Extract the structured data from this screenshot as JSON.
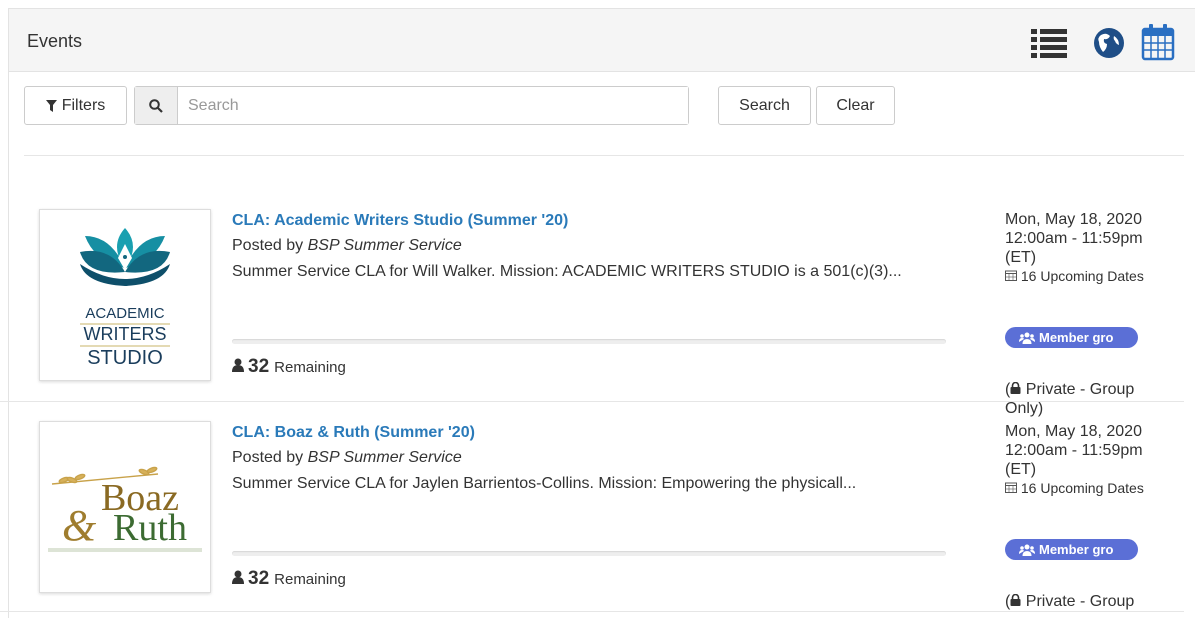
{
  "header": {
    "title": "Events",
    "views": [
      "list-view-icon",
      "globe-icon",
      "calendar-icon"
    ]
  },
  "toolbar": {
    "filters_label": "Filters",
    "search_placeholder": "Search",
    "search_value": "",
    "search_button": "Search",
    "clear_button": "Clear"
  },
  "events": [
    {
      "title": "CLA: Academic Writers Studio (Summer '20)",
      "posted_prefix": "Posted by",
      "posted_by": "BSP Summer Service",
      "description": "Summer Service CLA for Will Walker. Mission: ACADEMIC WRITERS STUDIO is a 501(c)(3)...",
      "remaining_count": "32",
      "remaining_label": "Remaining",
      "date": "Mon, May 18, 2020",
      "time": "12:00am - 11:59pm",
      "tz": "(ET)",
      "upcoming": "16 Upcoming Dates",
      "badge": "Member gro",
      "privacy": "Private - Group Only)",
      "logo": {
        "line1": "ACADEMIC",
        "line2": "WRITERS",
        "line3": "STUDIO"
      }
    },
    {
      "title": "CLA: Boaz & Ruth (Summer '20)",
      "posted_prefix": "Posted by",
      "posted_by": "BSP Summer Service",
      "description": "Summer Service CLA for Jaylen Barrientos-Collins. Mission: Empowering the physicall...",
      "remaining_count": "32",
      "remaining_label": "Remaining",
      "date": "Mon, May 18, 2020",
      "time": "12:00am - 11:59pm",
      "tz": "(ET)",
      "upcoming": "16 Upcoming Dates",
      "badge": "Member gro",
      "privacy": "Private - Group",
      "logo": {
        "line1": "Boaz",
        "line2": "Ruth"
      }
    }
  ],
  "colors": {
    "link": "#2a7ab9",
    "badge": "#5b6fd6",
    "icon": "#1f4e87"
  }
}
